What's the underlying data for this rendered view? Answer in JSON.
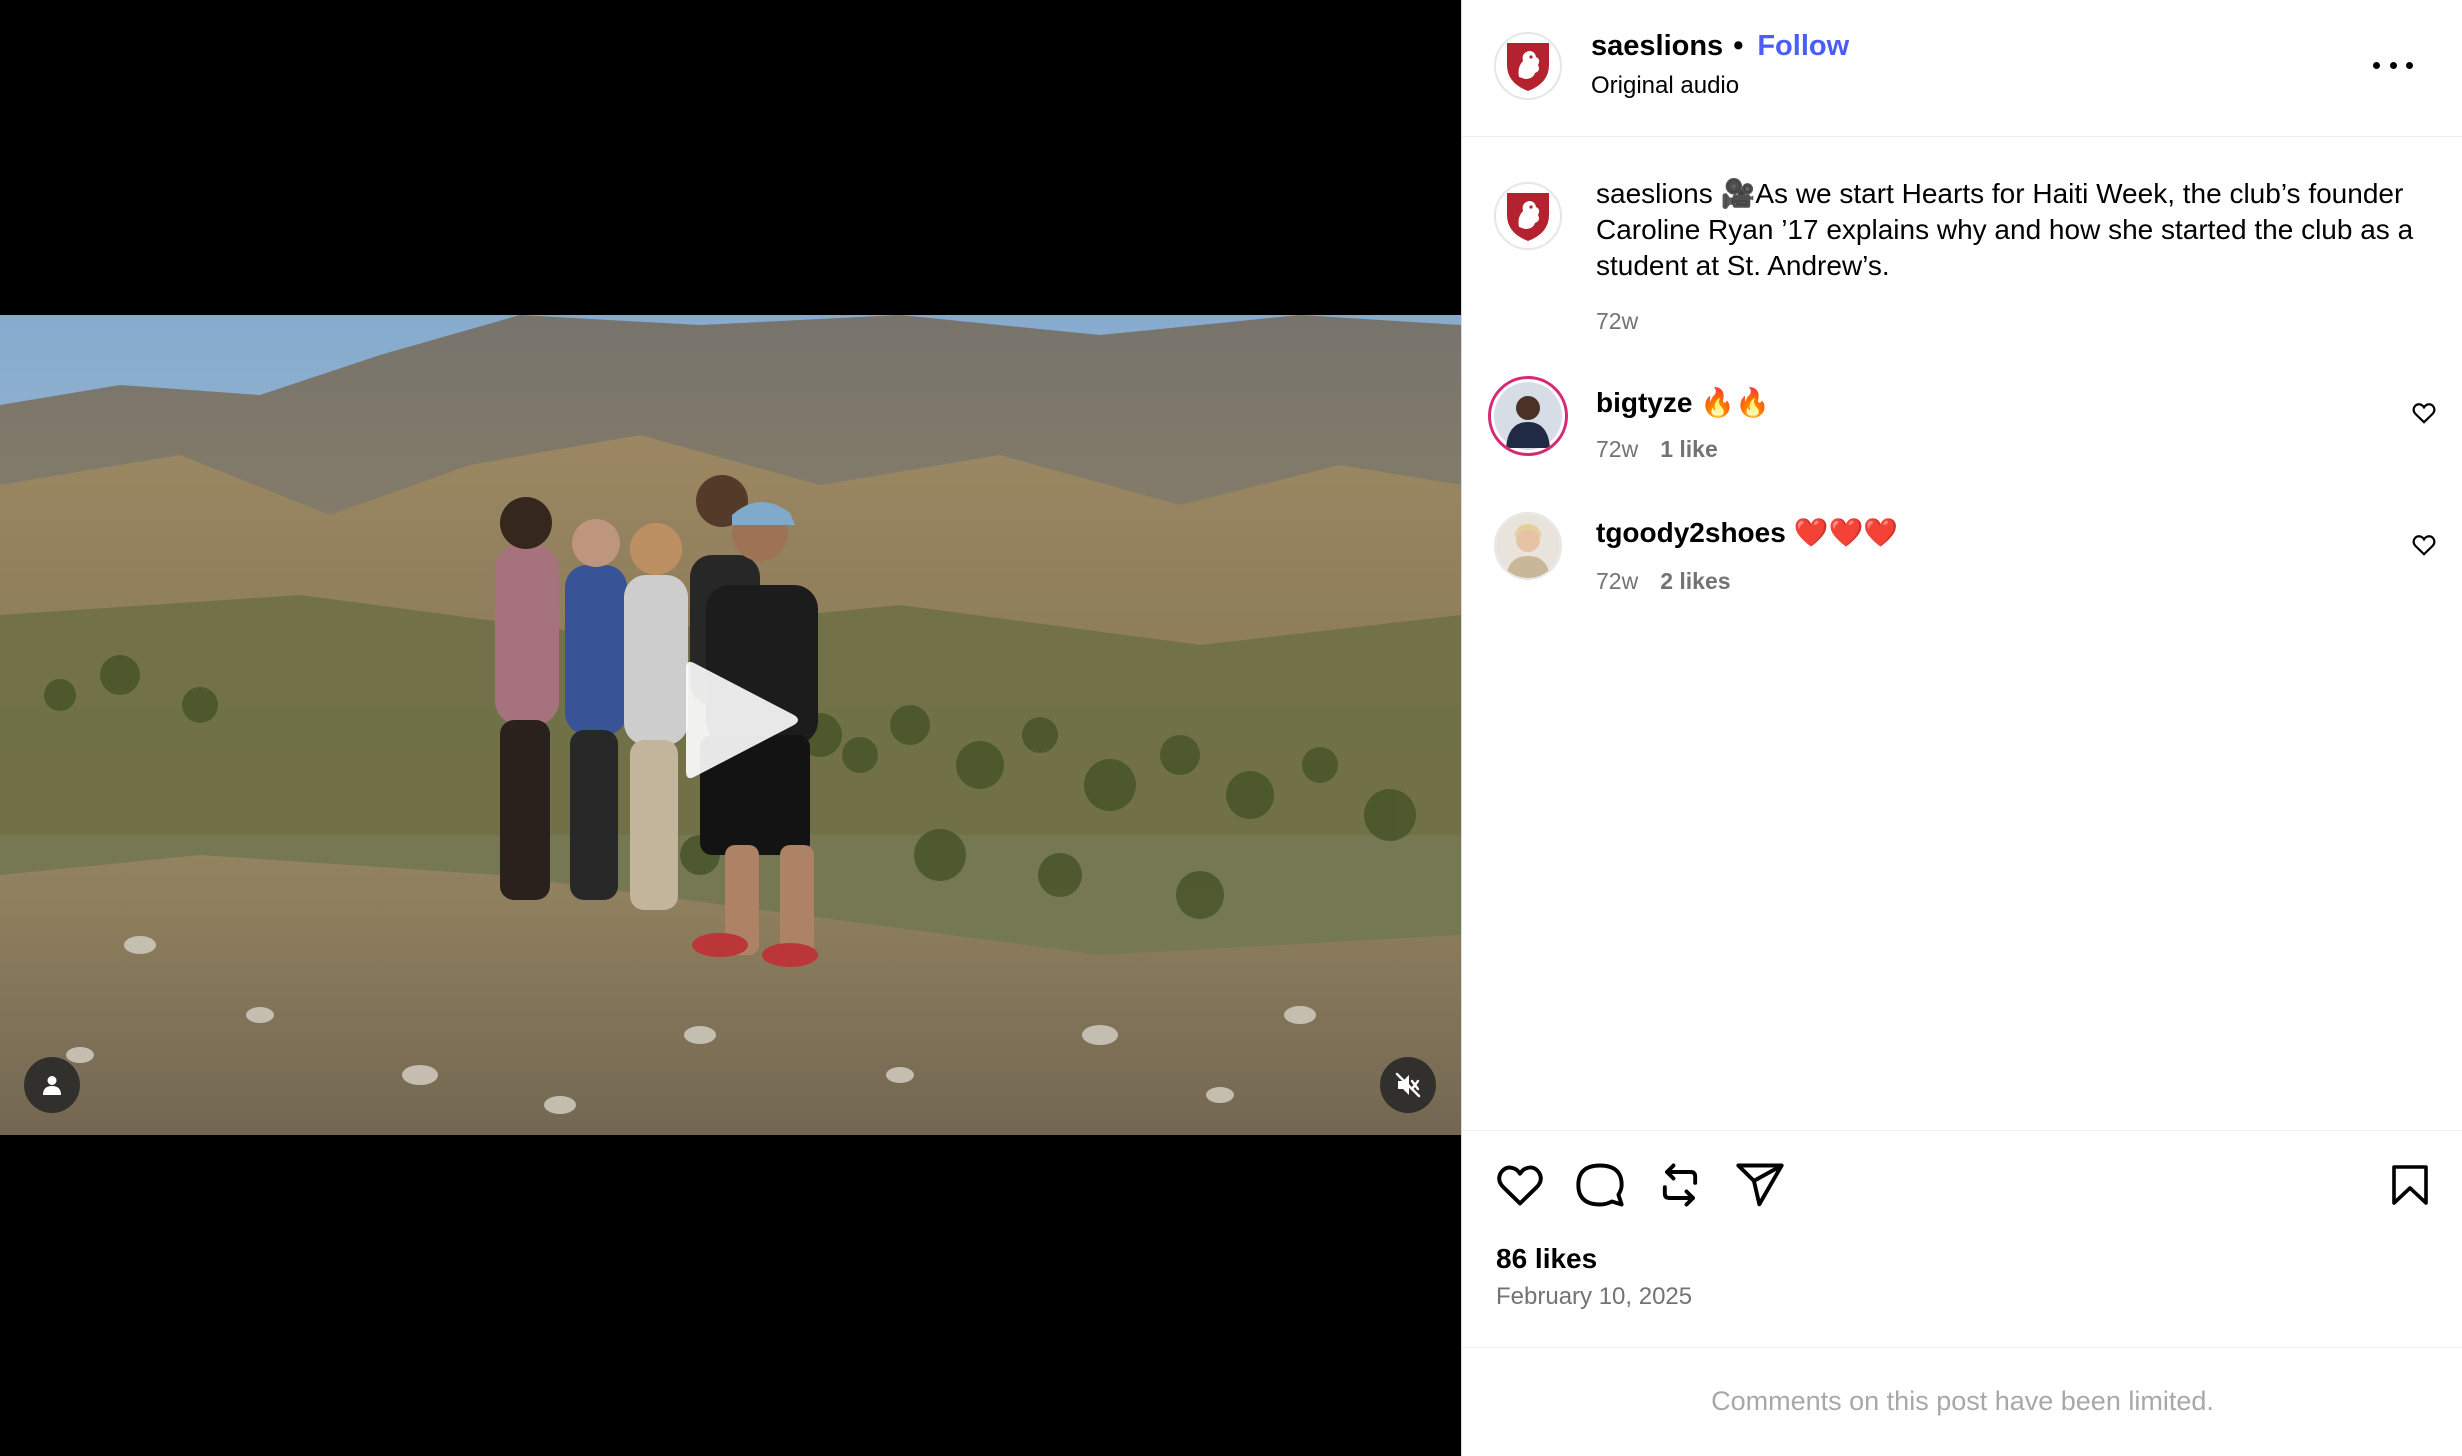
{
  "post": {
    "username": "saeslions",
    "follow_label": "Follow",
    "separator": "•",
    "audio_label": "Original audio"
  },
  "caption": {
    "username": "saeslions",
    "text": "🎥As we start Hearts for Haiti Week, the club’s founder Caroline Ryan ’17 explains why and how she started the club as a student at St. Andrew’s.",
    "time": "72w"
  },
  "comments": [
    {
      "username": "bigtyze",
      "text": "🔥🔥",
      "time": "72w",
      "likes": "1 like"
    },
    {
      "username": "tgoody2shoes",
      "text": "❤️❤️❤️",
      "time": "72w",
      "likes": "2 likes"
    }
  ],
  "actions": {
    "like_icon": "heart-icon",
    "comment_icon": "comment-icon",
    "repost_icon": "repost-icon",
    "share_icon": "share-icon",
    "save_icon": "bookmark-icon"
  },
  "stats": {
    "likes": "86 likes",
    "date": "February 10, 2025"
  },
  "footer": {
    "comments_limited": "Comments on this post have been limited."
  },
  "colors": {
    "accent": "#4a5df9",
    "muted": "#737373",
    "placeholder": "#a8a8a8",
    "logo_red": "#b3222e"
  }
}
